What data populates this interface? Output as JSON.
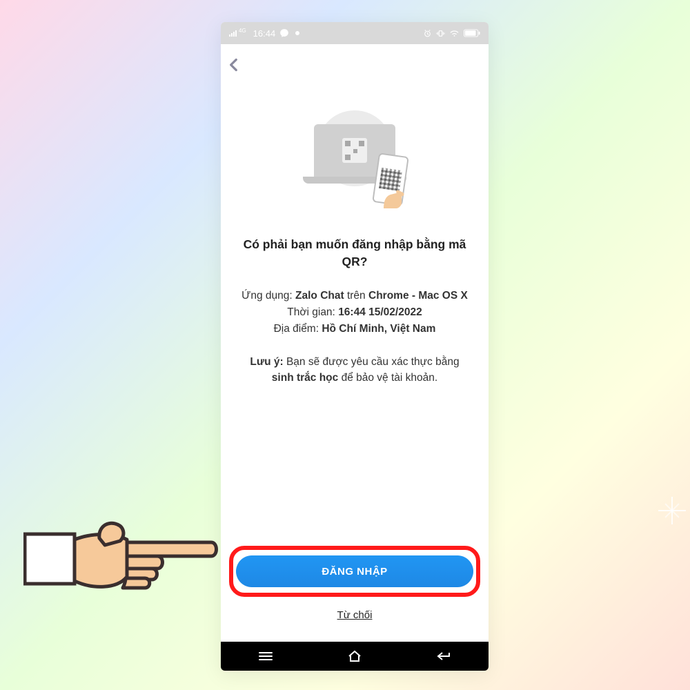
{
  "status_bar": {
    "network_label": "4G",
    "time": "16:44"
  },
  "main": {
    "heading": "Có phải bạn muốn đăng nhập bằng mã QR?",
    "app_label": "Ứng dụng:",
    "app_name": "Zalo Chat",
    "app_on": "trên",
    "app_browser": "Chrome - Mac OS X",
    "time_label": "Thời gian:",
    "time_value": "16:44 15/02/2022",
    "location_label": "Địa điểm:",
    "location_value": "Hồ Chí Minh, Việt Nam",
    "note_label": "Lưu ý:",
    "note_pre": "Bạn sẽ được yêu cầu xác thực bằng",
    "note_bold": "sinh trắc học",
    "note_post": "để bảo vệ tài khoản."
  },
  "actions": {
    "login": "ĐĂNG NHẬP",
    "decline": "Từ chối"
  }
}
